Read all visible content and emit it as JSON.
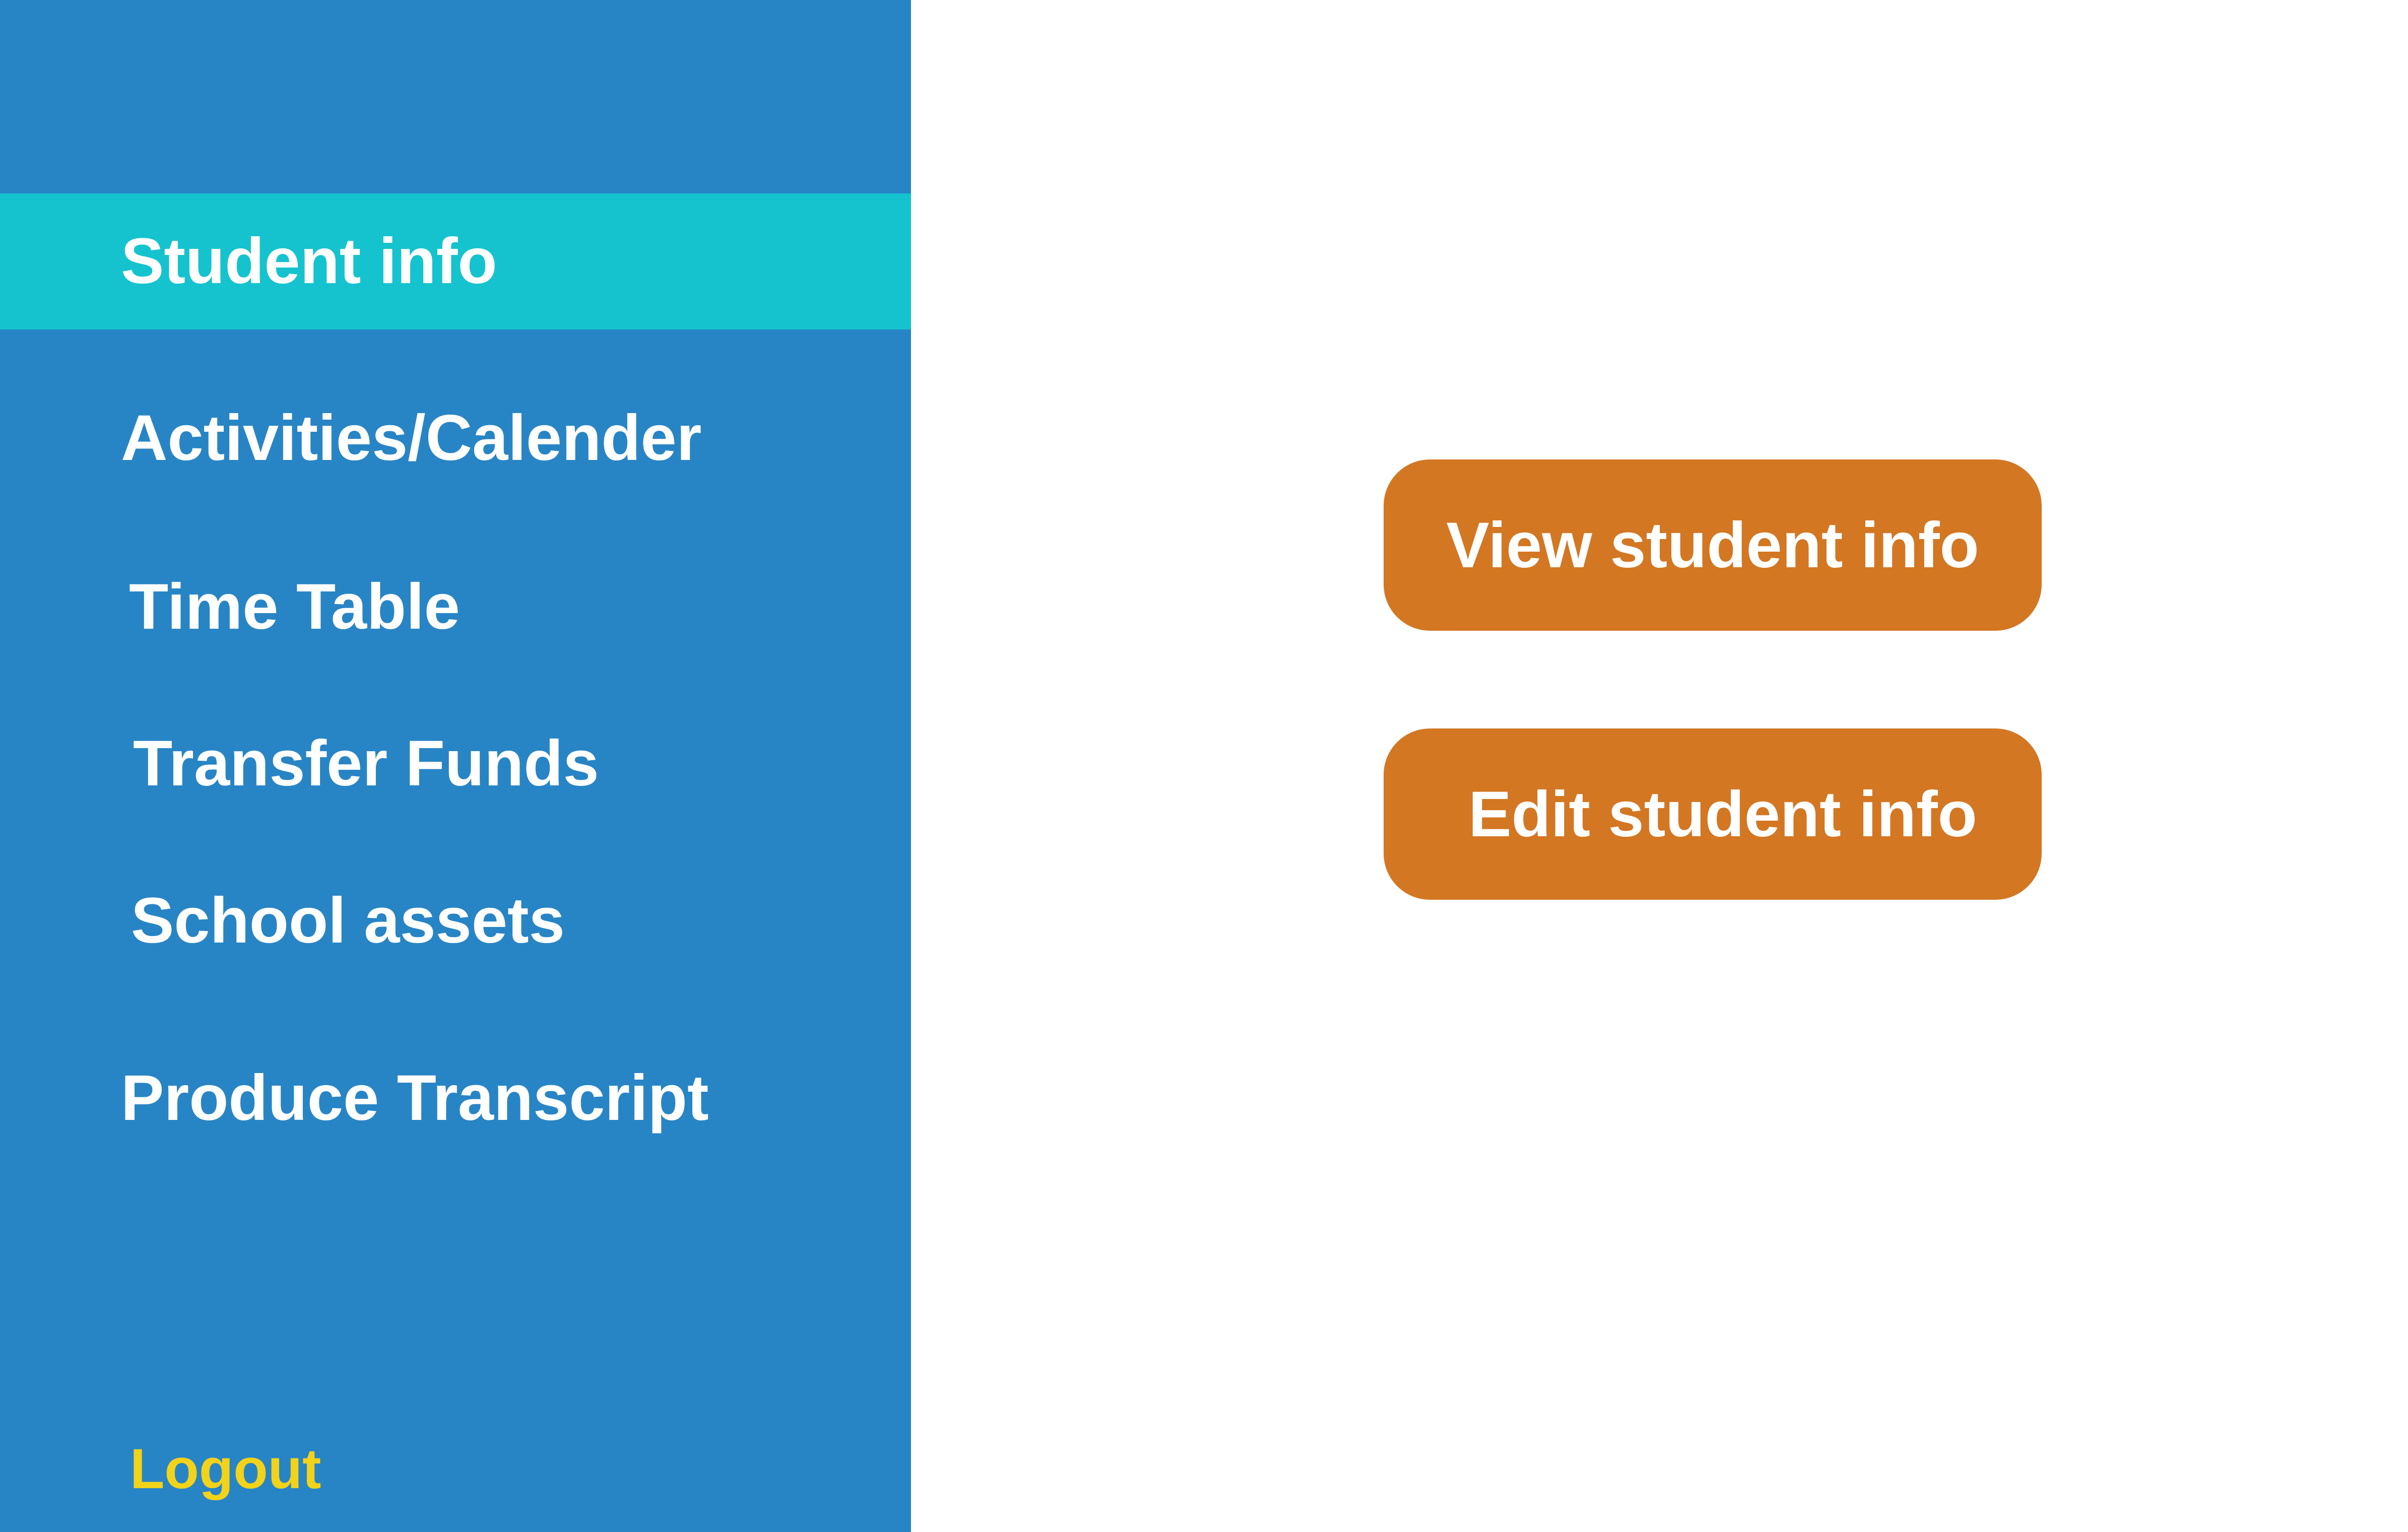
{
  "sidebar": {
    "items": [
      {
        "label": "Student info",
        "active": true
      },
      {
        "label": "Activities/Calender",
        "active": false
      },
      {
        "label": "Time Table",
        "active": false
      },
      {
        "label": "Transfer Funds",
        "active": false
      },
      {
        "label": "School assets",
        "active": false
      },
      {
        "label": "Produce Transcript",
        "active": false
      }
    ],
    "logout_label": "Logout"
  },
  "main": {
    "view_button_label": "View student info",
    "edit_button_label": "Edit student info"
  },
  "colors": {
    "sidebar_bg": "#2885c5",
    "active_item_bg": "#15c3cf",
    "button_bg": "#d37723",
    "logout_text": "#f3d21a"
  }
}
